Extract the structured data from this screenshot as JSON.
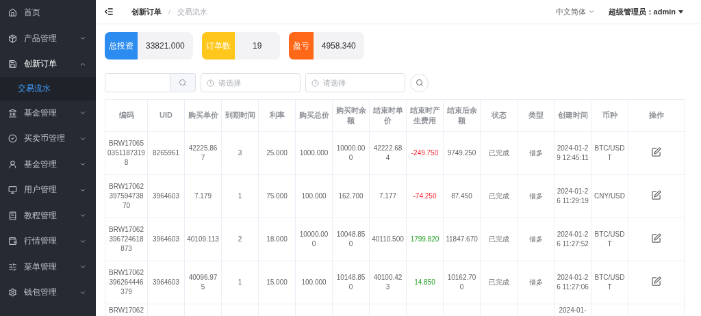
{
  "sidebar": {
    "items": [
      {
        "label": "首页"
      },
      {
        "label": "产品管理",
        "expanded": false
      },
      {
        "label": "创新订单",
        "expanded": true,
        "children": [
          {
            "label": "交易流水",
            "selected": true
          }
        ]
      },
      {
        "label": "基金管理",
        "expanded": false
      },
      {
        "label": "买卖币管理",
        "expanded": false
      },
      {
        "label": "基金管理",
        "expanded": false
      },
      {
        "label": "用户管理",
        "expanded": false
      },
      {
        "label": "教程管理",
        "expanded": false
      },
      {
        "label": "行情管理",
        "expanded": false
      },
      {
        "label": "菜单管理",
        "expanded": false
      },
      {
        "label": "钱包管理",
        "expanded": false
      }
    ]
  },
  "header": {
    "breadcrumb": [
      "创新订单",
      "交易流水"
    ],
    "breadcrumb_separator": "/",
    "language": "中文简体",
    "user": "超级管理员：admin"
  },
  "stats": [
    {
      "label": "总投资",
      "value": "33821.000",
      "color": "#2d8cf0"
    },
    {
      "label": "订单数",
      "value": "19",
      "color": "#ffc71c"
    },
    {
      "label": "盈亏",
      "value": "4958.340",
      "color": "#ff6818"
    }
  ],
  "filters": {
    "date_pickers": [
      {
        "placeholder": "请选择"
      },
      {
        "placeholder": "请选择"
      }
    ]
  },
  "table": {
    "columns": [
      "编码",
      "UID",
      "购买单价",
      "到期时间",
      "利率",
      "购买总价",
      "购买时余额",
      "结束时单价",
      "结束时产生费用",
      "结束后余额",
      "状态",
      "类型",
      "创建时间",
      "币种",
      "操作"
    ],
    "rows": [
      {
        "code": "BRW1706503511873198",
        "uid": "8265961",
        "unit_price": "42225.867",
        "term": "3",
        "rate": "25.000",
        "total": "1000.000",
        "balance_before": "10000.000",
        "end_price": "42222.684",
        "fee": {
          "text": "-249.750",
          "color": "#f5222d"
        },
        "balance_after": "9749.250",
        "status": "已完成",
        "type": "借多",
        "created": "2024-01-29 12:45:11",
        "currency": "BTC/USDT"
      },
      {
        "code": "BRW1706239759473870",
        "uid": "3964603",
        "unit_price": "7.179",
        "term": "1",
        "rate": "75.000",
        "total": "100.000",
        "balance_before": "162.700",
        "end_price": "7.177",
        "fee": {
          "text": "-74.250",
          "color": "#f5222d"
        },
        "balance_after": "87.450",
        "status": "已完成",
        "type": "借多",
        "created": "2024-01-26 11:29:19",
        "currency": "CNY/USD"
      },
      {
        "code": "BRW17062396724618873",
        "uid": "3964603",
        "unit_price": "40109.113",
        "term": "2",
        "rate": "18.000",
        "total": "10000.000",
        "balance_before": "10048.850",
        "end_price": "40110.500",
        "fee": {
          "text": "1799.820",
          "color": "#1e9e1e"
        },
        "balance_after": "11847.670",
        "status": "已完成",
        "type": "借多",
        "created": "2024-01-26 11:27:52",
        "currency": "BTC/USDT"
      },
      {
        "code": "BRW17062396264446379",
        "uid": "3964603",
        "unit_price": "40096.975",
        "term": "1",
        "rate": "15.000",
        "total": "100.000",
        "balance_before": "10148.850",
        "end_price": "40100.423",
        "fee": {
          "text": "14.850",
          "color": "#1e9e1e"
        },
        "balance_after": "10162.700",
        "status": "已完成",
        "type": "借多",
        "created": "2024-01-26 11:27:06",
        "currency": "BTC/USDT"
      },
      {
        "code": "BRW17062",
        "created": "2024-01-"
      }
    ]
  }
}
